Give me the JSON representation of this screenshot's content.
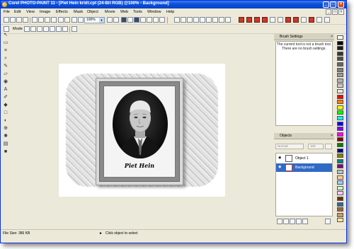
{
  "window": {
    "title": "Corel PHOTO-PAINT 11 - [Piet Hein kridt.cpt (24-Bit RGB) @100% - Background]",
    "controls": [
      "_",
      "□",
      "×"
    ]
  },
  "menu": [
    "File",
    "Edit",
    "View",
    "Image",
    "Effects",
    "Mask",
    "Object",
    "Movie",
    "Web",
    "Tools",
    "Window",
    "Help"
  ],
  "toolbar": {
    "zoom_value": "100%",
    "mode_label": "Mode"
  },
  "canvas": {
    "signature_text": "Piet Hein"
  },
  "brush_settings": {
    "title": "Brush Settings",
    "message_line1": "The current tool is not a brush tool.",
    "message_line2": "There are no brush settings."
  },
  "objects_panel": {
    "title": "Objects",
    "mode_value": "Normal",
    "opacity_value": "100",
    "items": [
      {
        "label": "Object 1",
        "selected": false
      },
      {
        "label": "Background",
        "selected": true
      }
    ]
  },
  "palette": [
    "#ffffff",
    "#000000",
    "#1a1a1a",
    "#333333",
    "#4d4d4d",
    "#666666",
    "#808080",
    "#999999",
    "#b3b3b3",
    "#cccccc",
    "#e6e6e6",
    "#ff0000",
    "#ff8000",
    "#ffff00",
    "#00ff00",
    "#00ffff",
    "#0000ff",
    "#8000ff",
    "#ff00ff",
    "#800000",
    "#008000",
    "#000080",
    "#808000",
    "#008080",
    "#800080",
    "#c0c0c0",
    "#ffcc99",
    "#99ccff",
    "#ccffcc",
    "#ffccff",
    "#663300",
    "#336699",
    "#996633",
    "#cc9966",
    "#ffe699"
  ],
  "statusbar": {
    "file_size": "File Size: 386 KB",
    "hint": "Click object to select"
  }
}
